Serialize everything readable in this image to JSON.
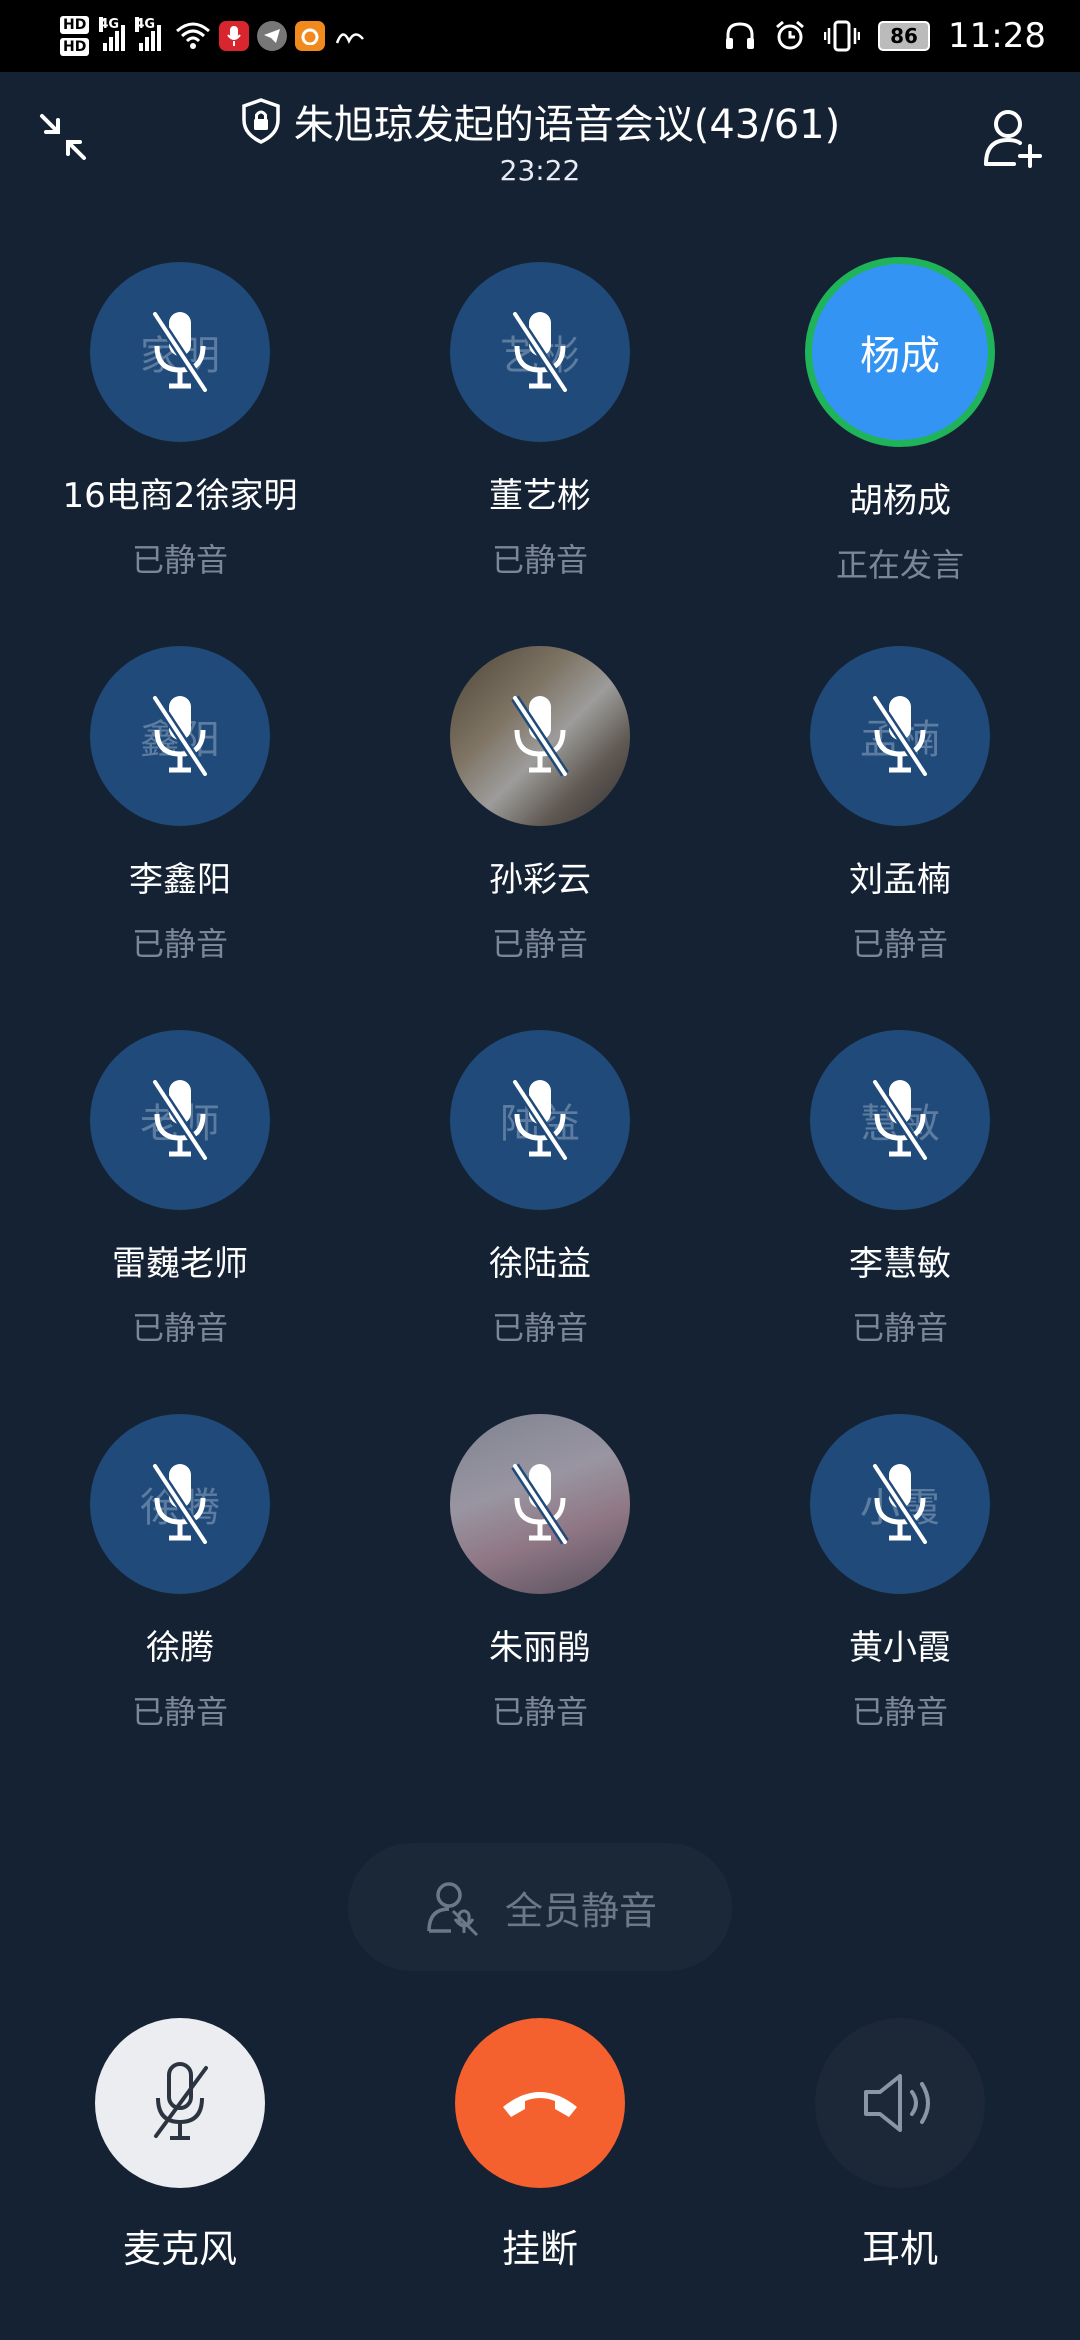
{
  "status_bar": {
    "hd1": "HD",
    "hd2": "HD",
    "net1": "4G",
    "net2": "4G",
    "battery": "86",
    "time": "11:28"
  },
  "header": {
    "title": "朱旭琼发起的语音会议(43/61)",
    "timer": "23:22"
  },
  "participants": [
    {
      "initials": "家明",
      "name": "16电商2徐家明",
      "status": "已静音"
    },
    {
      "initials": "艺彬",
      "name": "董艺彬",
      "status": "已静音"
    },
    {
      "initials": "杨成",
      "name": "胡杨成",
      "status": "正在发言"
    },
    {
      "initials": "鑫阳",
      "name": "李鑫阳",
      "status": "已静音"
    },
    {
      "initials": "",
      "name": "孙彩云",
      "status": "已静音"
    },
    {
      "initials": "孟楠",
      "name": "刘孟楠",
      "status": "已静音"
    },
    {
      "initials": "老师",
      "name": "雷巍老师",
      "status": "已静音"
    },
    {
      "initials": "陆益",
      "name": "徐陆益",
      "status": "已静音"
    },
    {
      "initials": "慧敏",
      "name": "李慧敏",
      "status": "已静音"
    },
    {
      "initials": "徐腾",
      "name": "徐腾",
      "status": "已静音"
    },
    {
      "initials": "",
      "name": "朱丽鹃",
      "status": "已静音"
    },
    {
      "initials": "小霞",
      "name": "黄小霞",
      "status": "已静音"
    }
  ],
  "mute_all_label": "全员静音",
  "controls": {
    "mic_label": "麦克风",
    "hangup_label": "挂断",
    "earpiece_label": "耳机"
  },
  "colors": {
    "background": "#152233",
    "avatar": "#1f4a7a",
    "speaking": "#3494f3",
    "speaking_ring": "#1fb35a",
    "hangup": "#f5612e",
    "muted_text": "#7b8696"
  }
}
